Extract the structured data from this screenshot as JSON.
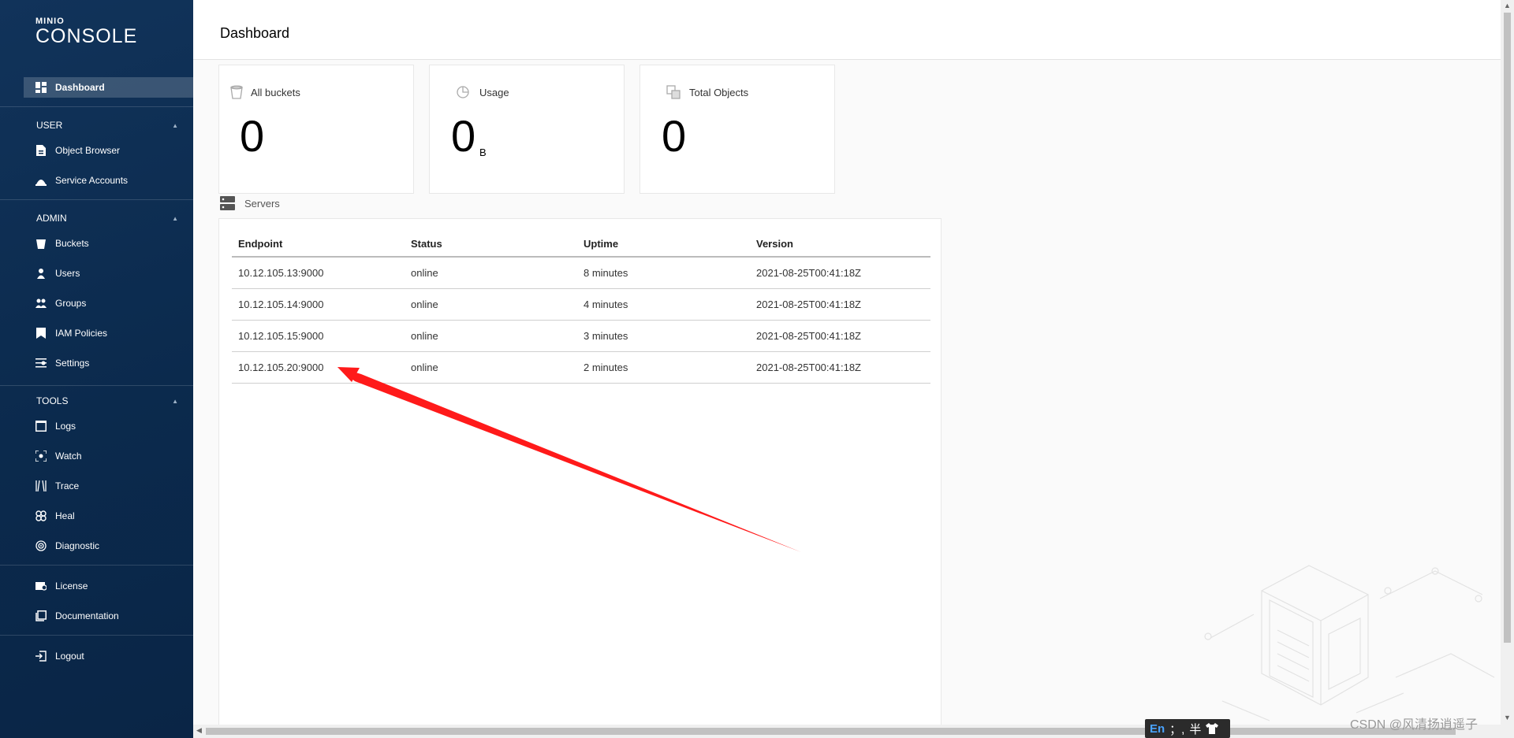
{
  "logo": {
    "brand": "MINIO",
    "product": "CONSOLE"
  },
  "header": {
    "title": "Dashboard"
  },
  "sidebar": {
    "dashboard": "Dashboard",
    "sections": [
      {
        "title": "USER",
        "items": [
          "Object Browser",
          "Service Accounts"
        ]
      },
      {
        "title": "ADMIN",
        "items": [
          "Buckets",
          "Users",
          "Groups",
          "IAM Policies",
          "Settings"
        ]
      },
      {
        "title": "TOOLS",
        "items": [
          "Logs",
          "Watch",
          "Trace",
          "Heal",
          "Diagnostic"
        ]
      }
    ],
    "footer_items": [
      "License",
      "Documentation"
    ],
    "logout": "Logout"
  },
  "cards": [
    {
      "label": "All buckets",
      "value": "0",
      "unit": ""
    },
    {
      "label": "Usage",
      "value": "0",
      "unit": "B"
    },
    {
      "label": "Total Objects",
      "value": "0",
      "unit": ""
    }
  ],
  "servers": {
    "title": "Servers",
    "columns": [
      "Endpoint",
      "Status",
      "Uptime",
      "Version"
    ],
    "rows": [
      [
        "10.12.105.13:9000",
        "online",
        "8 minutes",
        "2021-08-25T00:41:18Z"
      ],
      [
        "10.12.105.14:9000",
        "online",
        "4 minutes",
        "2021-08-25T00:41:18Z"
      ],
      [
        "10.12.105.15:9000",
        "online",
        "3 minutes",
        "2021-08-25T00:41:18Z"
      ],
      [
        "10.12.105.20:9000",
        "online",
        "2 minutes",
        "2021-08-25T00:41:18Z"
      ]
    ]
  },
  "ime": {
    "mode": "En",
    "punct": "；,",
    "width": "半"
  },
  "watermark": "CSDN @风清扬逍遥子",
  "colors": {
    "sidebar": "#0b2a4d",
    "annotation_arrow": "#ff1a1a"
  }
}
